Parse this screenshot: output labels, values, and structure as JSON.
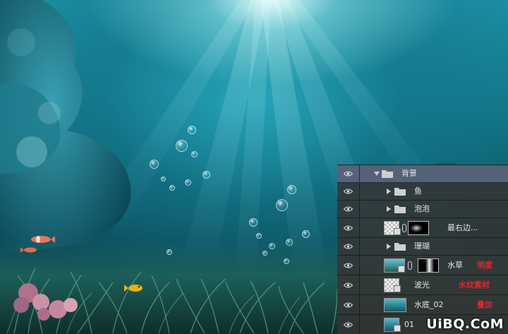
{
  "canvas": {
    "scene_name": "underwater-scene",
    "colors": {
      "light": "#e6ffff",
      "water_mid": "#14798c",
      "water_deep": "#082f37"
    }
  },
  "layers_panel": {
    "selected_color": "#5a6880",
    "note_color": "#e8232a",
    "layers": [
      {
        "name": "背景",
        "type": "group",
        "expanded": true,
        "icon": "folder-icon",
        "visible": true
      },
      {
        "name": "鱼",
        "type": "group",
        "expanded": false,
        "icon": "folder-icon",
        "visible": true
      },
      {
        "name": "泡泡",
        "type": "group",
        "expanded": false,
        "icon": "folder-icon",
        "visible": true
      },
      {
        "name": "最右边...",
        "type": "layer",
        "thumbnail": "transparent-thumbnail",
        "mask": "mask-thumbnail",
        "visible": true
      },
      {
        "name": "珊瑚",
        "type": "group",
        "expanded": false,
        "icon": "folder-icon",
        "visible": true
      },
      {
        "name": "水草",
        "type": "layer",
        "thumbnail": "seagrass-thumbnail",
        "mask": "mask-thumbnail",
        "note": "明度",
        "visible": true
      },
      {
        "name": "波光",
        "type": "layer",
        "thumbnail": "transparent-thumbnail",
        "note": "水纹素材",
        "visible": true
      },
      {
        "name": "水底_02",
        "type": "layer",
        "thumbnail": "water-thumbnail",
        "note": "叠加",
        "visible": true
      },
      {
        "name": "01",
        "type": "layer",
        "thumbnail": "water-thumbnail",
        "visible": true
      }
    ]
  },
  "watermark": {
    "text": "UiBQ.CoM"
  }
}
